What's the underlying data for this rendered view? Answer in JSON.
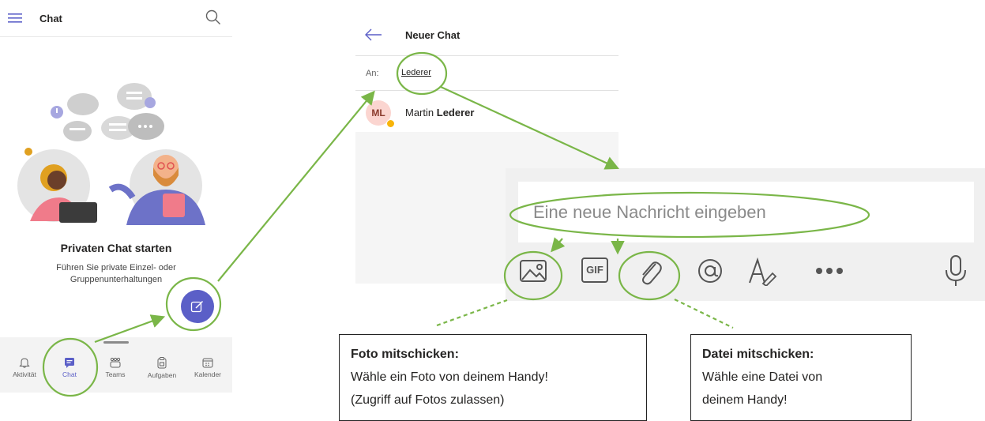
{
  "screen1": {
    "title": "Chat",
    "menu_icon": "hamburger-icon",
    "search_icon": "search-icon",
    "empty_state": {
      "title": "Privaten Chat starten",
      "description": "Führen Sie private Einzel- oder Gruppenunterhaltungen"
    },
    "fab_icon": "compose-icon",
    "nav": [
      {
        "label": "Aktivität",
        "icon": "bell-icon"
      },
      {
        "label": "Chat",
        "icon": "chat-icon",
        "active": true
      },
      {
        "label": "Teams",
        "icon": "teams-icon"
      },
      {
        "label": "Aufgaben",
        "icon": "clipboard-icon"
      },
      {
        "label": "Kalender",
        "icon": "calendar-icon"
      }
    ]
  },
  "screen2": {
    "title": "Neuer Chat",
    "to_label": "An:",
    "to_value": "Lederer",
    "suggestion": {
      "initials": "ML",
      "first": "Martin",
      "last": "Lederer"
    }
  },
  "composer": {
    "placeholder": "Eine neue Nachricht eingeben",
    "tools": [
      "image-icon",
      "gif-icon",
      "attach-icon",
      "mention-icon",
      "format-icon",
      "more-icon",
      "mic-icon"
    ],
    "gif_label": "GIF"
  },
  "callouts": {
    "photo": {
      "title": "Foto mitschicken:",
      "line1": "Wähle ein Foto von deinem Handy!",
      "line2": "(Zugriff auf Fotos zulassen)"
    },
    "file": {
      "title": "Datei mitschicken:",
      "line1": "Wähle eine Datei von",
      "line2": "deinem Handy!"
    }
  },
  "colors": {
    "accent": "#5b5fc7",
    "highlight": "#7ab648"
  }
}
